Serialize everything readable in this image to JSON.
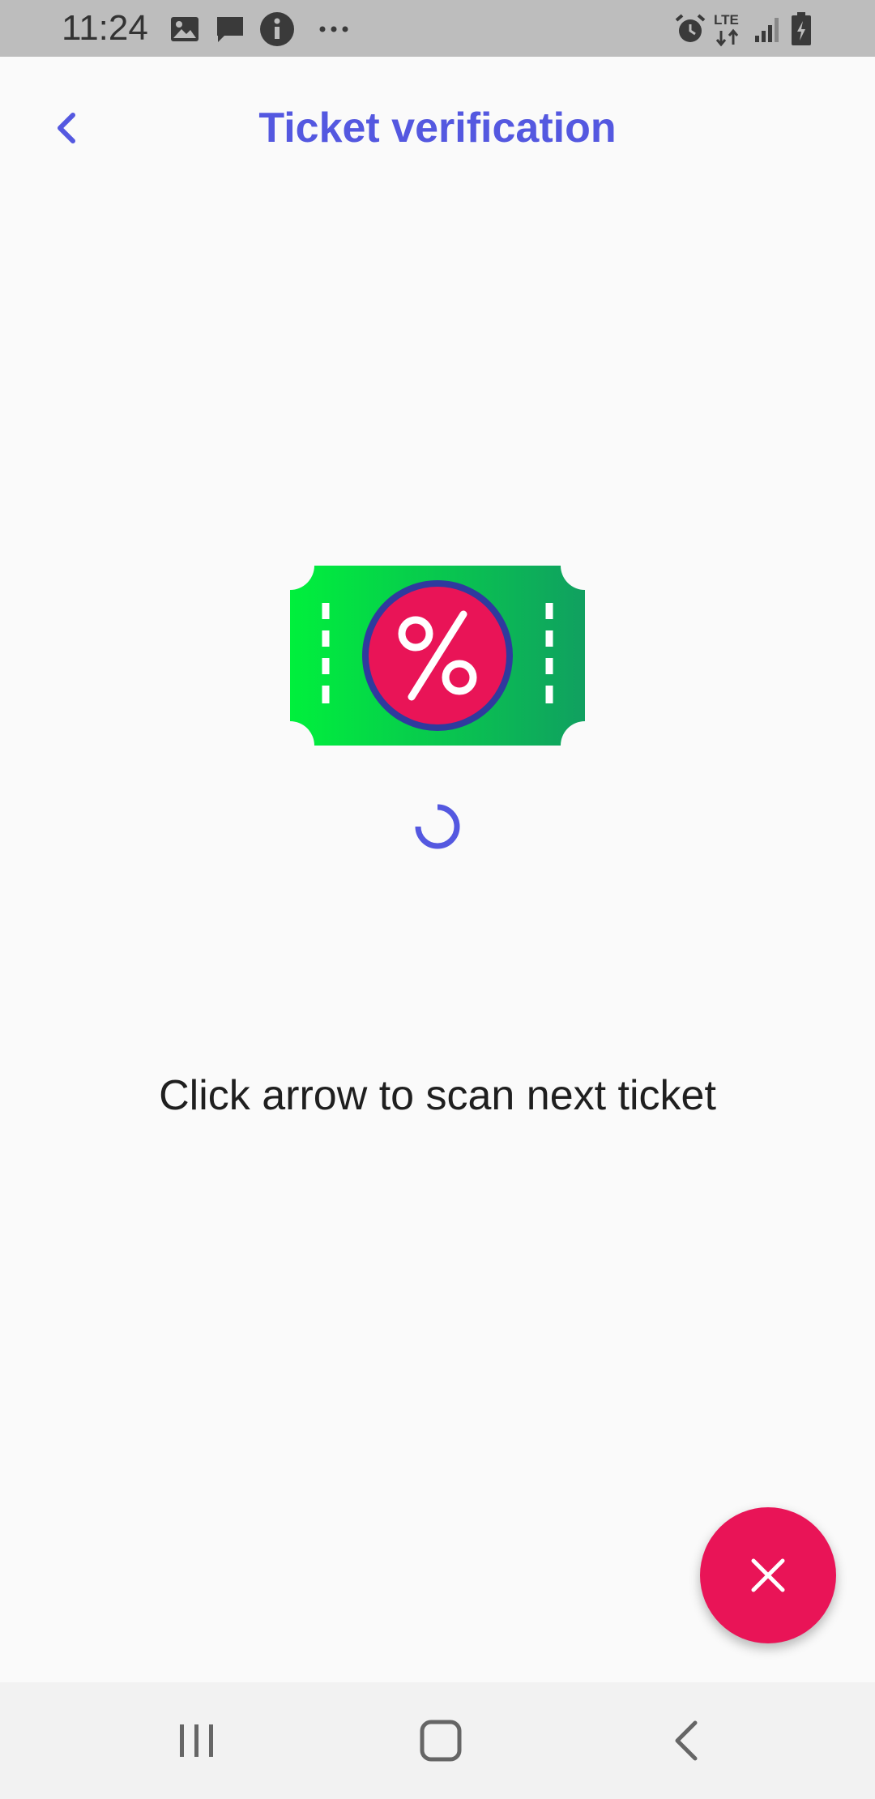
{
  "status_bar": {
    "time": "11:24",
    "left_icons": [
      "image-icon",
      "message-icon",
      "info-icon",
      "more-icon"
    ],
    "right_icons": [
      "alarm-icon",
      "lte-icon",
      "signal-icon",
      "battery-icon"
    ],
    "network_label": "LTE"
  },
  "app_bar": {
    "title": "Ticket verification",
    "back_icon": "chevron-left-icon"
  },
  "main": {
    "illustration_icon": "discount-ticket-icon",
    "loading": true,
    "instruction": "Click arrow to scan next ticket"
  },
  "fab": {
    "icon": "close-icon"
  },
  "nav_bar": {
    "buttons": [
      "recent-apps-icon",
      "home-icon",
      "back-icon"
    ]
  },
  "colors": {
    "accent": "#5458e0",
    "fab": "#e91457",
    "ticket_green_light": "#00f03c",
    "ticket_green_dark": "#10a060",
    "ticket_circle": "#e91457",
    "ticket_ring": "#2f3a9e"
  }
}
